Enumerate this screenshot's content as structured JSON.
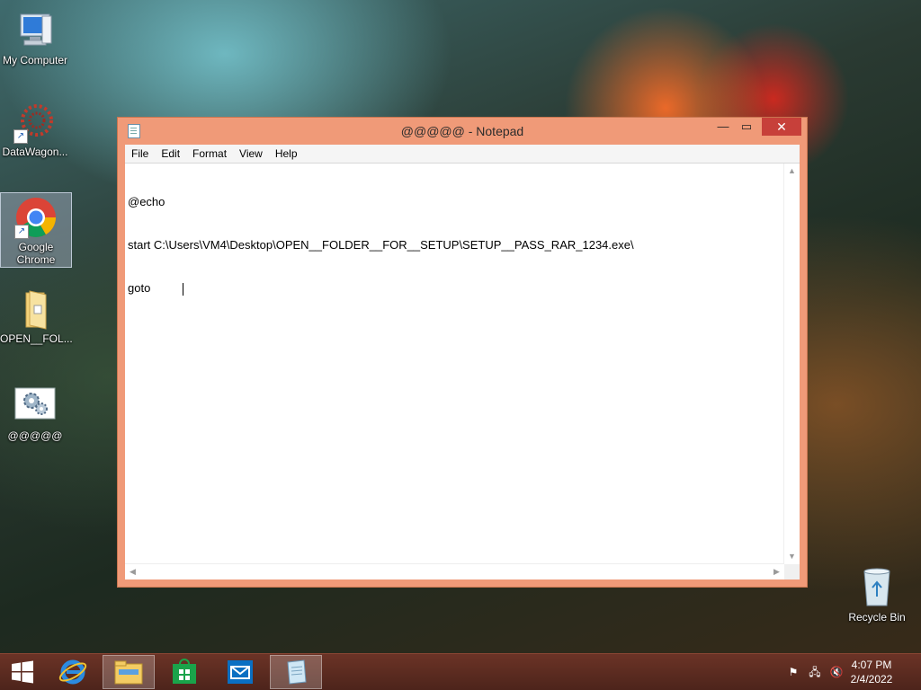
{
  "desktop": {
    "icons": [
      {
        "label": "My Computer"
      },
      {
        "label": "DataWagon..."
      },
      {
        "label": "Google Chrome"
      },
      {
        "label": "OPEN__FOL..."
      },
      {
        "label": "@@@@@"
      },
      {
        "label": "Recycle Bin"
      }
    ]
  },
  "notepad": {
    "title": "@@@@@ - Notepad",
    "menu": [
      "File",
      "Edit",
      "Format",
      "View",
      "Help"
    ],
    "lines": [
      "@echo",
      "start C:\\Users\\VM4\\Desktop\\OPEN__FOLDER__FOR__SETUP\\SETUP__PASS_RAR_1234.exe\\",
      "goto"
    ],
    "close_glyph": "✕",
    "max_glyph": "▭",
    "min_glyph": "—"
  },
  "taskbar": {
    "time": "4:07 PM",
    "date": "2/4/2022"
  },
  "colors": {
    "window_frame": "#f09a78",
    "close_button": "#c7403a",
    "taskbar": "#5a2a1f"
  }
}
